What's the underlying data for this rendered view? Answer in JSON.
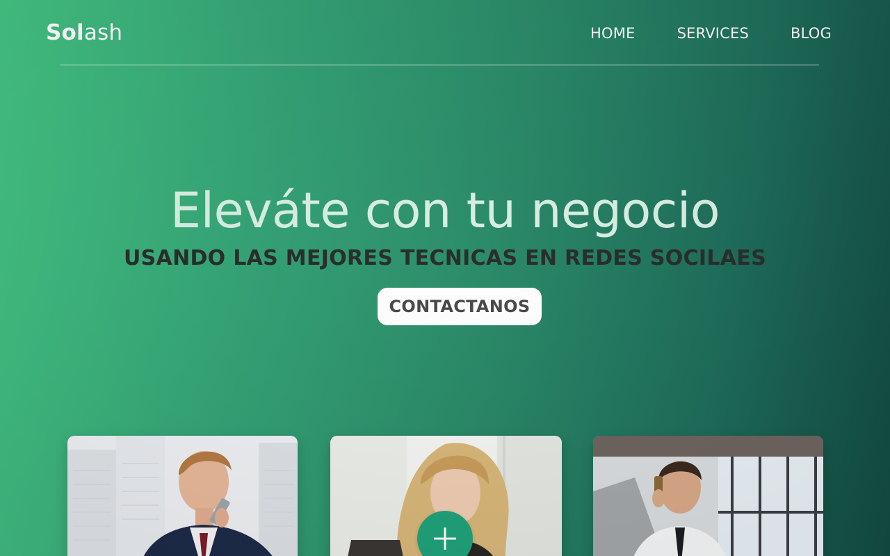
{
  "brand": {
    "bold": "Sol",
    "light": "ash"
  },
  "nav": {
    "items": [
      {
        "label": "HOME"
      },
      {
        "label": "SERVICES"
      },
      {
        "label": "BLOG"
      }
    ]
  },
  "hero": {
    "title": "Eleváte con tu negocio",
    "subtitle": "USANDO  LAS MEJORES TECNICAS EN REDES SOCILAES",
    "cta_label": "CONTACTANOS"
  },
  "colors": {
    "gradient_start": "#44c383",
    "gradient_end": "#124a42",
    "accent": "#1fa37a"
  },
  "icons": {
    "plus": "plus-icon"
  }
}
